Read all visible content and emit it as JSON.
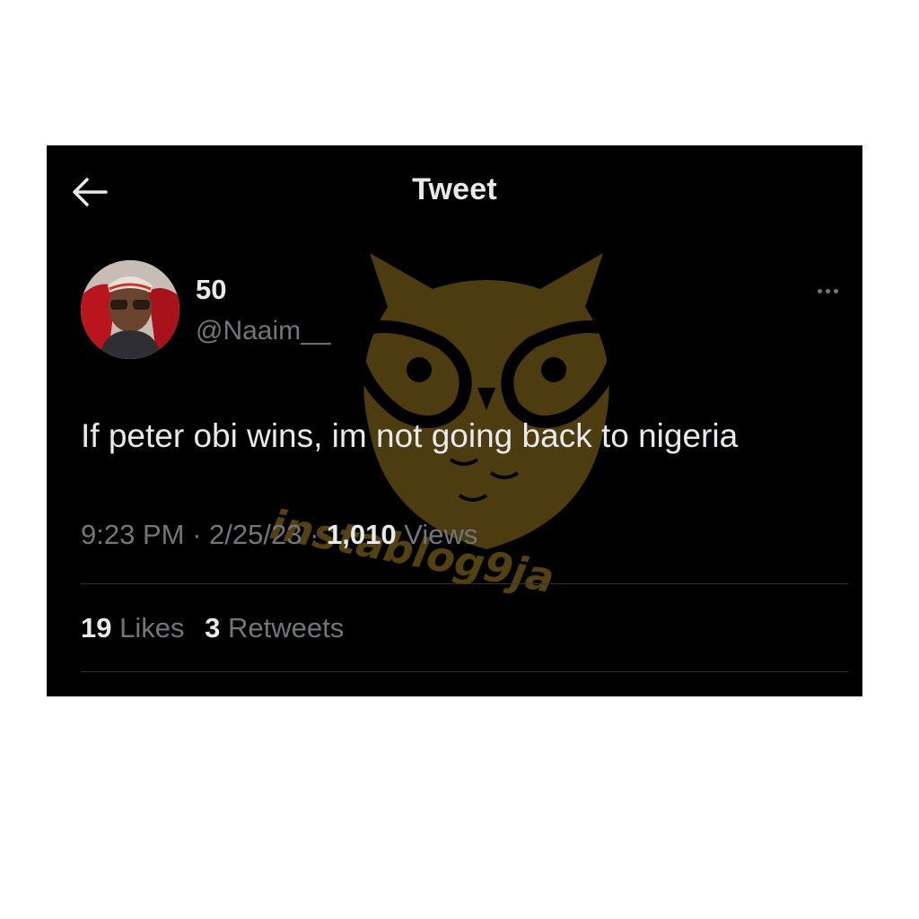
{
  "header": {
    "title": "Tweet",
    "back_icon": "arrow-left-icon"
  },
  "tweet": {
    "display_name": "50",
    "handle": "@Naaim__",
    "text": "If peter obi wins, im not going back to nigeria",
    "time": "9:23 PM",
    "date": "2/25/23",
    "separator": "·",
    "views_count": "1,010",
    "views_label": "Views",
    "likes_count": "19",
    "likes_label": "Likes",
    "retweets_count": "3",
    "retweets_label": "Retweets",
    "more_icon": "more-horizontal-icon"
  },
  "watermark": {
    "text": "instablog9ja",
    "logo": "owl-with-glasses-logo"
  },
  "colors": {
    "background": "#000000",
    "text_primary": "#e7e9ea",
    "text_secondary": "#71767b",
    "divider": "#2f3336",
    "watermark": "#8a6d1e"
  }
}
